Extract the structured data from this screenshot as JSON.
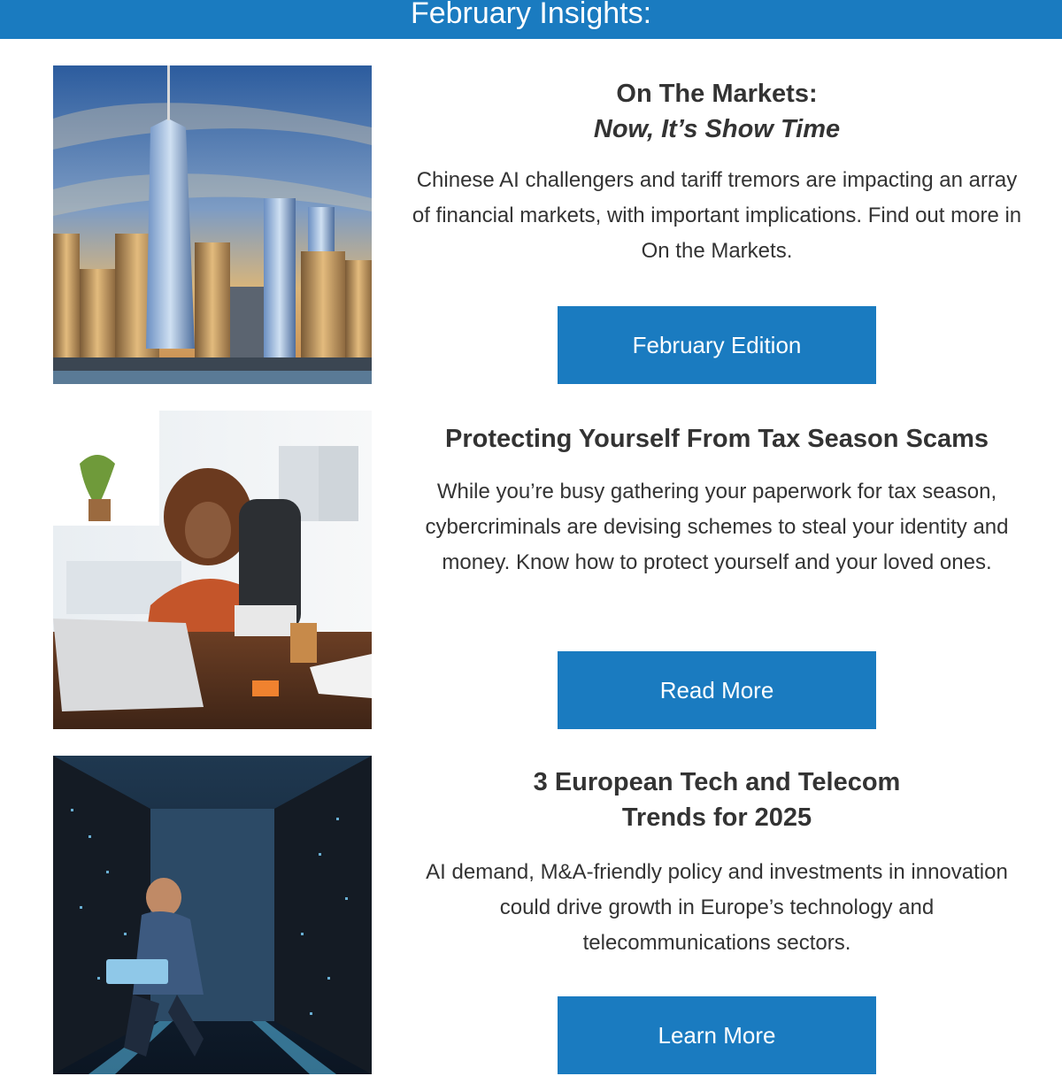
{
  "header": {
    "title": "February Insights:"
  },
  "cards": [
    {
      "title": "On The Markets:",
      "subtitle": "Now, It’s Show Time",
      "body": "Chinese AI challengers and tariff tremors are impacting an array of financial markets, with important implications. Find out more in On the Markets.",
      "cta": "February Edition",
      "image": "city-skyline-image"
    },
    {
      "title": "Protecting Yourself From Tax Season Scams",
      "body": "While you’re busy gathering your paperwork for tax season, cybercriminals are devising schemes to steal your identity and money. Know how to protect yourself and your loved ones.",
      "cta": "Read More",
      "image": "woman-at-laptop-image"
    },
    {
      "title": "3 European Tech and Telecom",
      "subtitle": "Trends for 2025",
      "body": "AI demand, M&A-friendly policy and investments in innovation could drive growth in Europe’s technology and telecommunications sectors.",
      "cta": "Learn More",
      "image": "data-center-image"
    }
  ],
  "colors": {
    "accent": "#1a7bc0",
    "text": "#333333"
  }
}
